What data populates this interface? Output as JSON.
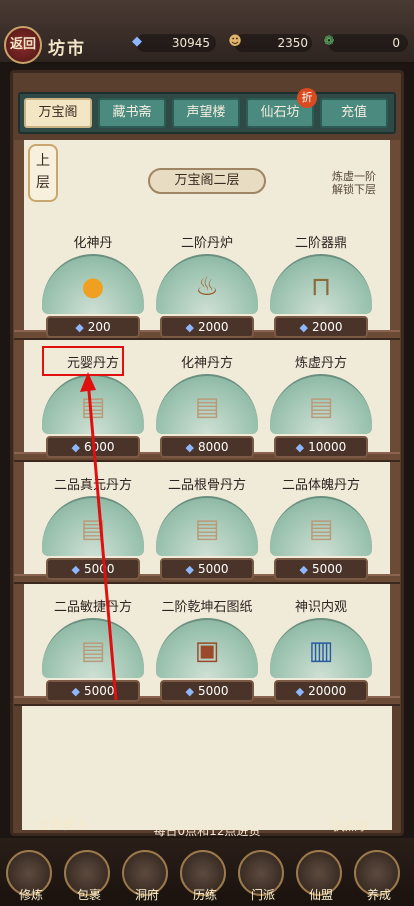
{
  "header": {
    "back_label": "返回",
    "title": "坊市",
    "resources": [
      {
        "icon": "spirit-stone-icon",
        "value": "30945"
      },
      {
        "icon": "merchant-icon",
        "value": "2350"
      },
      {
        "icon": "jade-icon",
        "value": "0"
      }
    ]
  },
  "tabs": [
    {
      "label": "万宝阁"
    },
    {
      "label": "藏书斋"
    },
    {
      "label": "声望楼"
    },
    {
      "label": "仙石坊"
    },
    {
      "label": "充值"
    }
  ],
  "tab_badge": "折",
  "floor": {
    "lantern": "上层",
    "name": "万宝阁二层",
    "unlock_text": "炼虚一阶\n解锁下层"
  },
  "items": [
    {
      "name": "化神丹",
      "price": "200",
      "icon": "golden-pill-icon"
    },
    {
      "name": "二阶丹炉",
      "price": "2000",
      "icon": "alchemy-furnace-icon"
    },
    {
      "name": "二阶器鼎",
      "price": "2000",
      "icon": "tripod-cauldron-icon"
    },
    {
      "name": "元婴丹方",
      "price": "6000",
      "icon": "recipe-scroll-icon"
    },
    {
      "name": "化神丹方",
      "price": "8000",
      "icon": "recipe-scroll-icon"
    },
    {
      "name": "炼虚丹方",
      "price": "10000",
      "icon": "recipe-scroll-icon"
    },
    {
      "name": "二品真元丹方",
      "price": "5000",
      "icon": "recipe-scroll-icon"
    },
    {
      "name": "二品根骨丹方",
      "price": "5000",
      "icon": "recipe-scroll-icon"
    },
    {
      "name": "二品体魄丹方",
      "price": "5000",
      "icon": "recipe-scroll-icon"
    },
    {
      "name": "二品敏捷丹方",
      "price": "5000",
      "icon": "recipe-scroll-icon"
    },
    {
      "name": "二阶乾坤石图纸",
      "price": "5000",
      "icon": "blueprint-icon"
    },
    {
      "name": "神识内观",
      "price": "20000",
      "icon": "book-icon"
    }
  ],
  "restock_text": "每日0点和12点进货",
  "npc_left": "云游商人",
  "npc_right": "执点事",
  "nav": [
    {
      "label": "修炼"
    },
    {
      "label": "包裹"
    },
    {
      "label": "洞府"
    },
    {
      "label": "历练"
    },
    {
      "label": "门派"
    },
    {
      "label": "仙盟"
    },
    {
      "label": "养成"
    }
  ]
}
